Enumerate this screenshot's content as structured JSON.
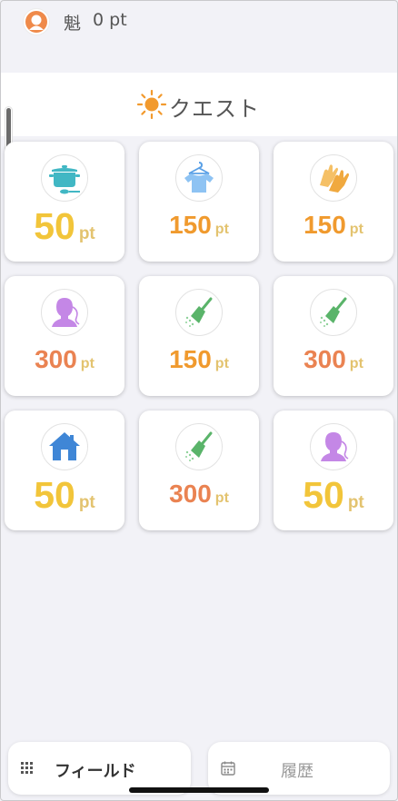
{
  "user": {
    "name": "魁",
    "points_label": "0 pt"
  },
  "header": {
    "title": "クエスト"
  },
  "colors": {
    "yellow": "#f2c53a",
    "orange": "#f09a2e",
    "coral": "#ea8352",
    "unit": "#e3c36f"
  },
  "quests": [
    {
      "icon": "cooking-pot-icon",
      "points": "50",
      "unit": "pt"
    },
    {
      "icon": "shirt-hanger-icon",
      "points": "150",
      "unit": "pt"
    },
    {
      "icon": "gloves-icon",
      "points": "150",
      "unit": "pt"
    },
    {
      "icon": "person-face-icon",
      "points": "300",
      "unit": "pt"
    },
    {
      "icon": "broom-icon",
      "points": "150",
      "unit": "pt"
    },
    {
      "icon": "broom-icon",
      "points": "300",
      "unit": "pt"
    },
    {
      "icon": "house-icon",
      "points": "50",
      "unit": "pt"
    },
    {
      "icon": "broom-icon",
      "points": "300",
      "unit": "pt"
    },
    {
      "icon": "person-face-icon",
      "points": "50",
      "unit": "pt"
    }
  ],
  "bottom_nav": {
    "field_label": "フィールド",
    "history_label": "履歴"
  }
}
